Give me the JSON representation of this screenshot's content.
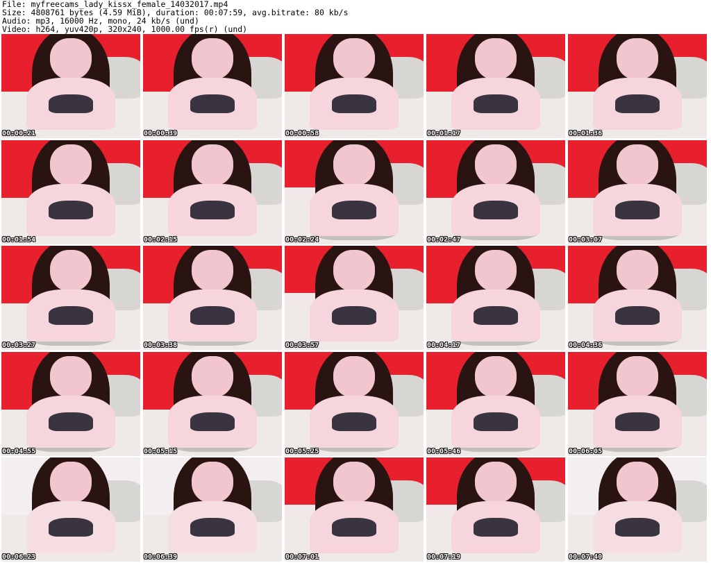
{
  "header": {
    "file": "File: myfreecams_lady_kissx_female_14032017.mp4",
    "size": "Size: 4808761 bytes (4.59 MiB), duration: 00:07:59, avg.bitrate: 80 kb/s",
    "audio": "Audio: mp3, 16000 Hz, mono, 24 kb/s (und)",
    "video": "Video: h264, yuv420p, 320x240, 1000.00 fps(r) (und)"
  },
  "thumbnails": [
    {
      "timestamp": "00:00:21"
    },
    {
      "timestamp": "00:00:39"
    },
    {
      "timestamp": "00:00:58"
    },
    {
      "timestamp": "00:01:17"
    },
    {
      "timestamp": "00:01:36"
    },
    {
      "timestamp": "00:01:54"
    },
    {
      "timestamp": "00:02:15"
    },
    {
      "timestamp": "00:02:24"
    },
    {
      "timestamp": "00:02:47"
    },
    {
      "timestamp": "00:03:07"
    },
    {
      "timestamp": "00:03:27"
    },
    {
      "timestamp": "00:03:38"
    },
    {
      "timestamp": "00:03:57"
    },
    {
      "timestamp": "00:04:17"
    },
    {
      "timestamp": "00:04:36"
    },
    {
      "timestamp": "00:04:55"
    },
    {
      "timestamp": "00:05:15"
    },
    {
      "timestamp": "00:05:25"
    },
    {
      "timestamp": "00:05:46"
    },
    {
      "timestamp": "00:06:05"
    },
    {
      "timestamp": "00:06:23"
    },
    {
      "timestamp": "00:06:39"
    },
    {
      "timestamp": "00:07:01"
    },
    {
      "timestamp": "00:07:19"
    },
    {
      "timestamp": "00:07:40"
    }
  ]
}
